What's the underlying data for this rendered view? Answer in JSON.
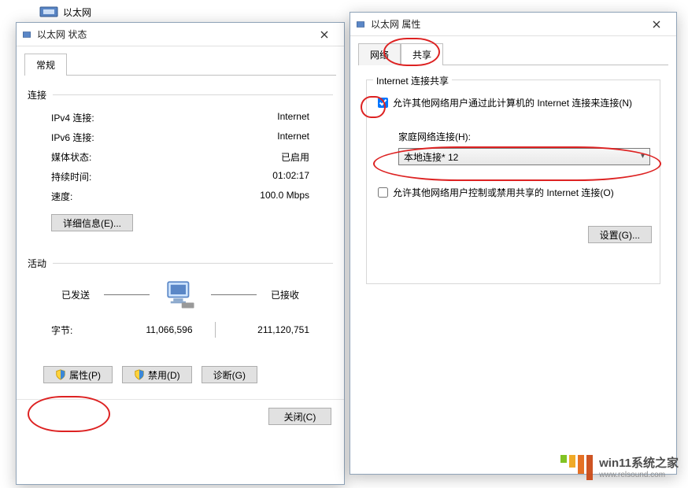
{
  "network_item": {
    "label": "以太网"
  },
  "status": {
    "title": "以太网 状态",
    "tab_general": "常规",
    "group_connection": "连接",
    "rows": [
      {
        "label": "IPv4 连接:",
        "value": "Internet"
      },
      {
        "label": "IPv6 连接:",
        "value": "Internet"
      },
      {
        "label": "媒体状态:",
        "value": "已启用"
      },
      {
        "label": "持续时间:",
        "value": "01:02:17"
      },
      {
        "label": "速度:",
        "value": "100.0 Mbps"
      }
    ],
    "details_btn": "详细信息(E)...",
    "group_activity": "活动",
    "sent_label": "已发送",
    "recv_label": "已接收",
    "bytes_label": "字节:",
    "bytes_sent": "11,066,596",
    "bytes_recv": "211,120,751",
    "btn_props": "属性(P)",
    "btn_disable": "禁用(D)",
    "btn_diag": "诊断(G)",
    "btn_close": "关闭(C)"
  },
  "props": {
    "title": "以太网 属性",
    "tab_network": "网络",
    "tab_sharing": "共享",
    "group_ics": "Internet 连接共享",
    "chk_allow": "允许其他网络用户通过此计算机的 Internet 连接来连接(N)",
    "home_label": "家庭网络连接(H):",
    "home_value": "本地连接* 12",
    "chk_control": "允许其他网络用户控制或禁用共享的 Internet 连接(O)",
    "btn_settings": "设置(G)..."
  },
  "watermark": {
    "line1": "win11系统之家",
    "line2": "www.relsound.com"
  }
}
